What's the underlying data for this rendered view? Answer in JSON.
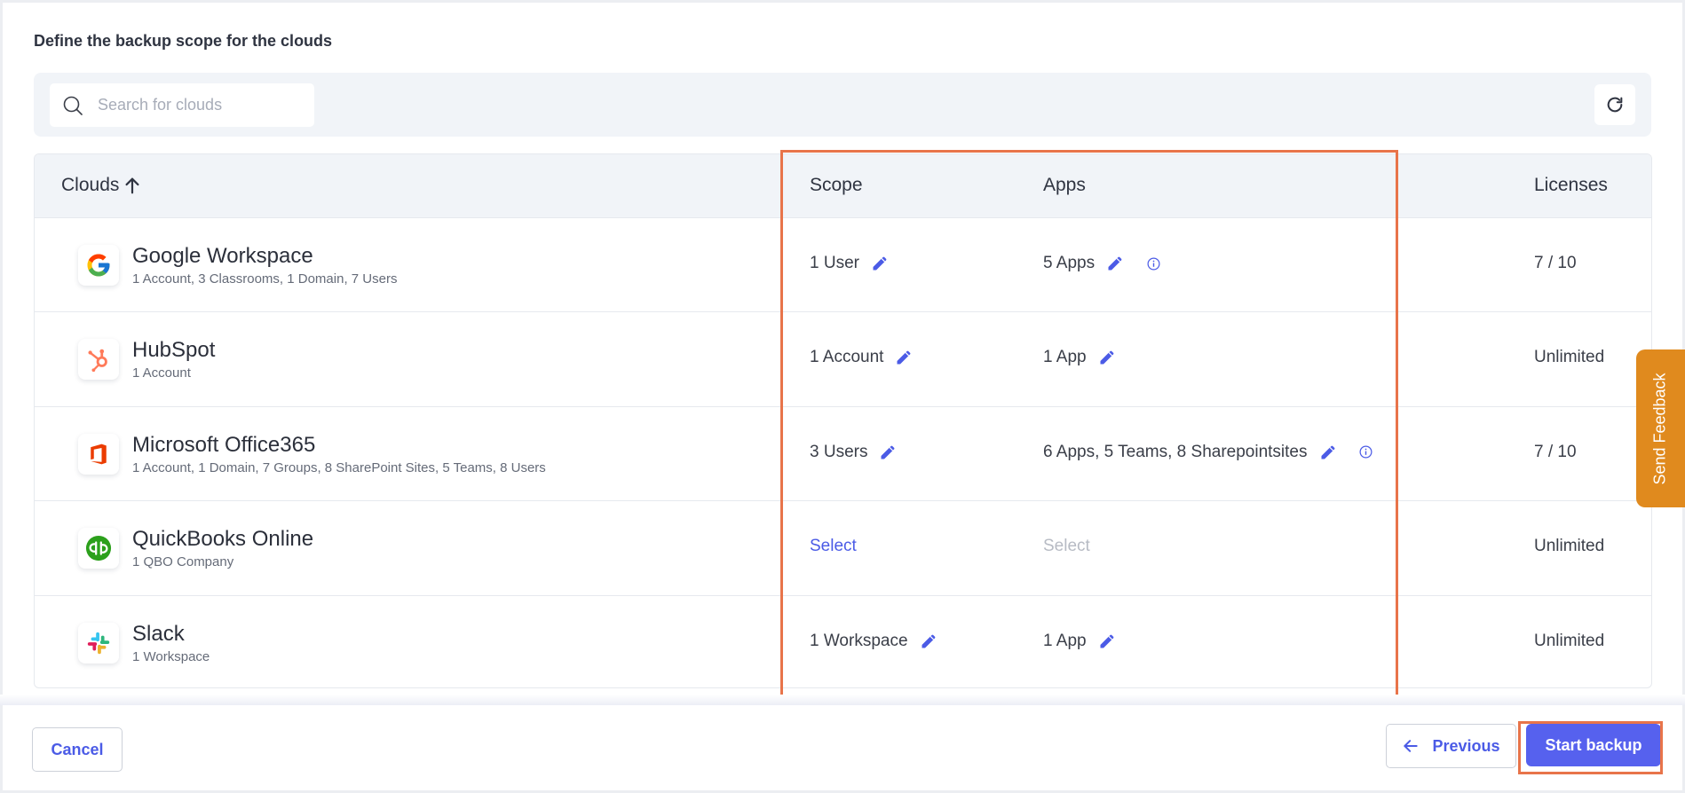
{
  "page": {
    "title": "Define the backup scope for the clouds"
  },
  "search": {
    "placeholder": "Search for clouds",
    "value": ""
  },
  "icons": {
    "search": "search-icon",
    "refresh": "refresh-icon",
    "sort": "arrow-up-icon",
    "edit": "pencil-icon",
    "info": "info-icon",
    "back": "arrow-left-icon"
  },
  "table": {
    "columns": {
      "clouds": "Clouds",
      "scope": "Scope",
      "apps": "Apps",
      "licenses": "Licenses"
    },
    "rows": [
      {
        "name": "Google Workspace",
        "details": "1 Account, 3 Classrooms, 1 Domain, 7 Users",
        "scope": "1 User",
        "apps": "5 Apps",
        "licenses": "7 / 10",
        "logo": "google-logo"
      },
      {
        "name": "HubSpot",
        "details": "1 Account",
        "scope": "1 Account",
        "apps": "1 App",
        "licenses": "Unlimited",
        "logo": "hubspot-logo"
      },
      {
        "name": "Microsoft Office365",
        "details": "1 Account, 1 Domain, 7 Groups, 8 SharePoint Sites, 5 Teams, 8 Users",
        "scope": "3 Users",
        "apps": "6 Apps, 5 Teams, 8 Sharepointsites",
        "licenses": "7 / 10",
        "logo": "office365-logo"
      },
      {
        "name": "QuickBooks Online",
        "details": "1 QBO Company",
        "scope": "Select",
        "apps": "Select",
        "licenses": "Unlimited",
        "logo": "quickbooks-logo"
      },
      {
        "name": "Slack",
        "details": "1 Workspace",
        "scope": "1 Workspace",
        "apps": "1 App",
        "licenses": "Unlimited",
        "logo": "slack-logo"
      }
    ]
  },
  "footer": {
    "cancel": "Cancel",
    "previous": "Previous",
    "start": "Start backup"
  },
  "feedback": {
    "label": "Send Feedback"
  },
  "colors": {
    "accent": "#5661ee",
    "highlight": "#e8744a",
    "feedback": "#e08a1e"
  }
}
